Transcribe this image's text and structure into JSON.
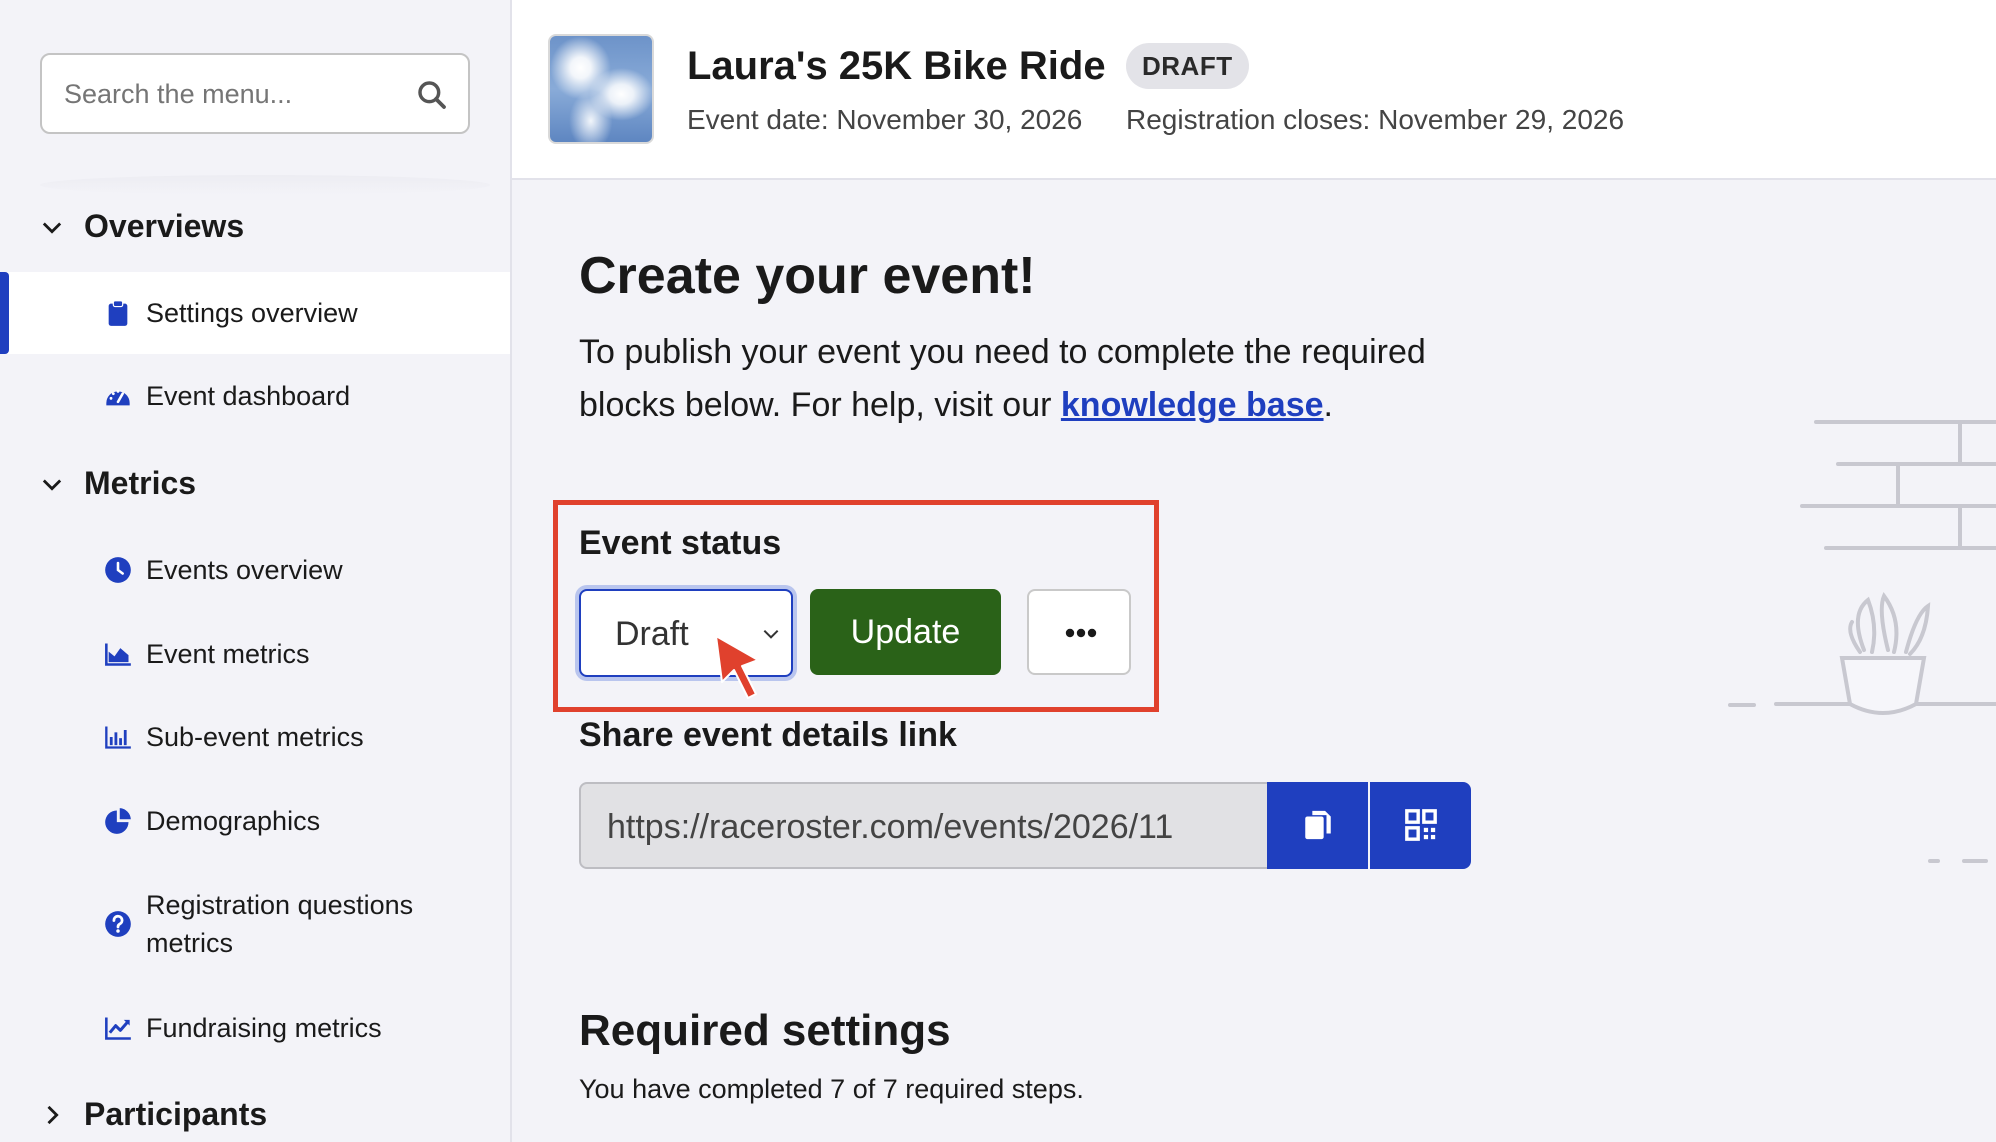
{
  "sidebar": {
    "search_placeholder": "Search the menu...",
    "groups": [
      {
        "label": "Overviews",
        "expanded": true
      },
      {
        "label": "Metrics",
        "expanded": true
      },
      {
        "label": "Participants",
        "expanded": false
      }
    ],
    "items": [
      {
        "label": "Settings overview",
        "icon": "clipboard-icon",
        "active": true
      },
      {
        "label": "Event dashboard",
        "icon": "gauge-icon"
      },
      {
        "label": "Events overview",
        "icon": "clock-icon"
      },
      {
        "label": "Event metrics",
        "icon": "area-chart-icon"
      },
      {
        "label": "Sub-event metrics",
        "icon": "bar-chart-icon"
      },
      {
        "label": "Demographics",
        "icon": "pie-chart-icon"
      },
      {
        "label": "Registration questions metrics",
        "icon": "question-circle-icon"
      },
      {
        "label": "Fundraising metrics",
        "icon": "line-chart-icon"
      }
    ]
  },
  "header": {
    "title": "Laura's 25K Bike Ride",
    "badge": "DRAFT",
    "event_date": "Event date: November 30, 2026",
    "registration_closes": "Registration closes: November 29, 2026"
  },
  "main": {
    "title": "Create your event!",
    "intro_text": "To publish your event you need to complete the required blocks below. For help, visit our",
    "intro_link": "knowledge base",
    "intro_end": ".",
    "status_label": "Event status",
    "status_value": "Draft",
    "update_label": "Update",
    "share_label": "Share event details link",
    "share_url": "https://raceroster.com/events/2026/11",
    "required_title": "Required settings",
    "required_subtitle": "You have completed 7 of 7 required steps."
  },
  "colors": {
    "accent": "#1f3fbf",
    "update_button": "#2a6218",
    "highlight": "#e0412d",
    "background": "#f3f3f8"
  }
}
